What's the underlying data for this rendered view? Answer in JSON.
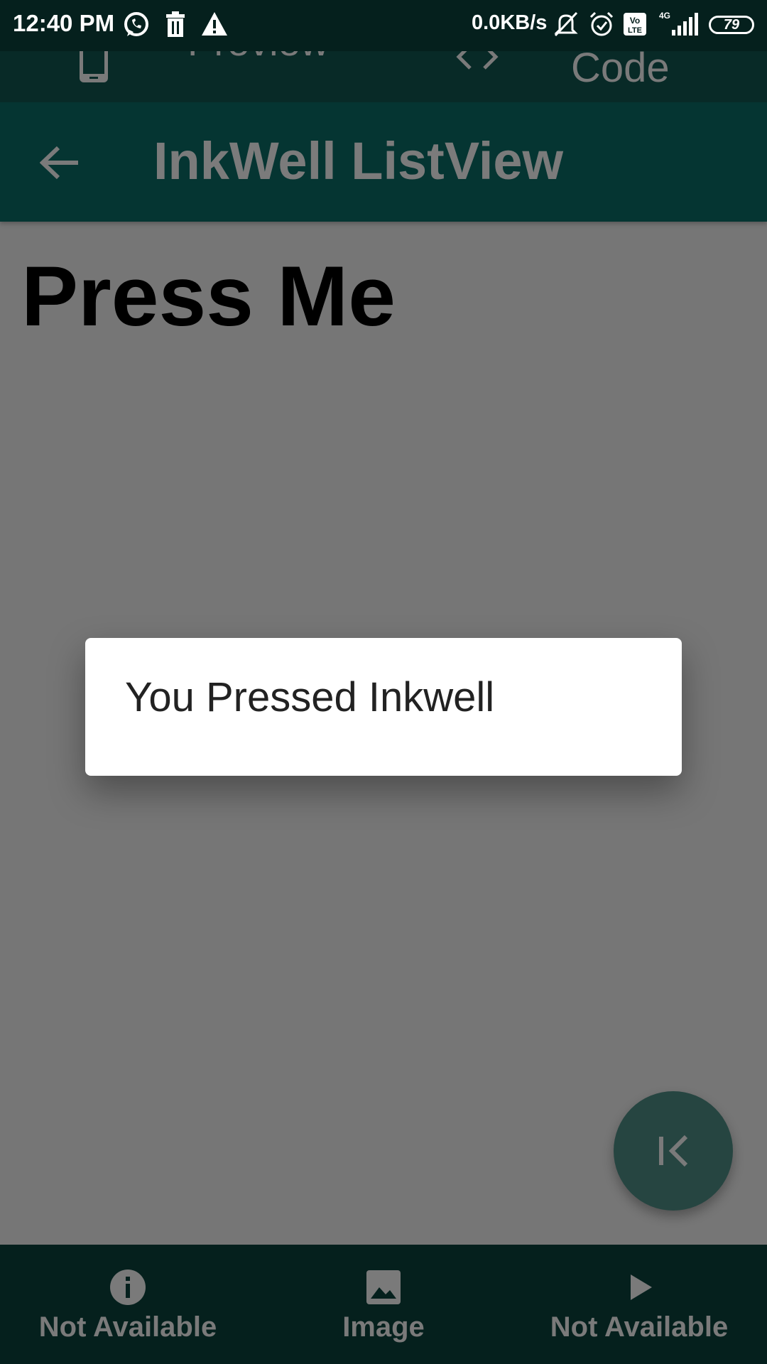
{
  "status_bar": {
    "time": "12:40 PM",
    "speed": "0.0KB/s",
    "battery": "79",
    "icons": [
      "whatsapp-icon",
      "trash-icon",
      "warning-icon",
      "mute-icon",
      "alarm-icon",
      "volte-icon",
      "signal-icon",
      "battery-icon"
    ]
  },
  "tabs": {
    "preview_label": "Preview",
    "code_label": "Code",
    "icons": [
      "phone-icon",
      "code-icon"
    ]
  },
  "appbar": {
    "title": "InkWell ListView",
    "back_icon": "arrow-back-icon"
  },
  "main": {
    "press_me": "Press Me"
  },
  "dialog": {
    "message": "You Pressed Inkwell"
  },
  "fab": {
    "icon": "collapse-left-icon"
  },
  "bottom_nav": {
    "items": [
      {
        "label": "Not Available",
        "icon": "info-icon"
      },
      {
        "label": "Image",
        "icon": "image-icon"
      },
      {
        "label": "Not Available",
        "icon": "play-icon"
      }
    ]
  },
  "colors": {
    "status_bar": "#05201d",
    "appbar": "#053532",
    "scrim": "#767676",
    "fab": "#264541",
    "muted_text": "#7a7a7a"
  }
}
